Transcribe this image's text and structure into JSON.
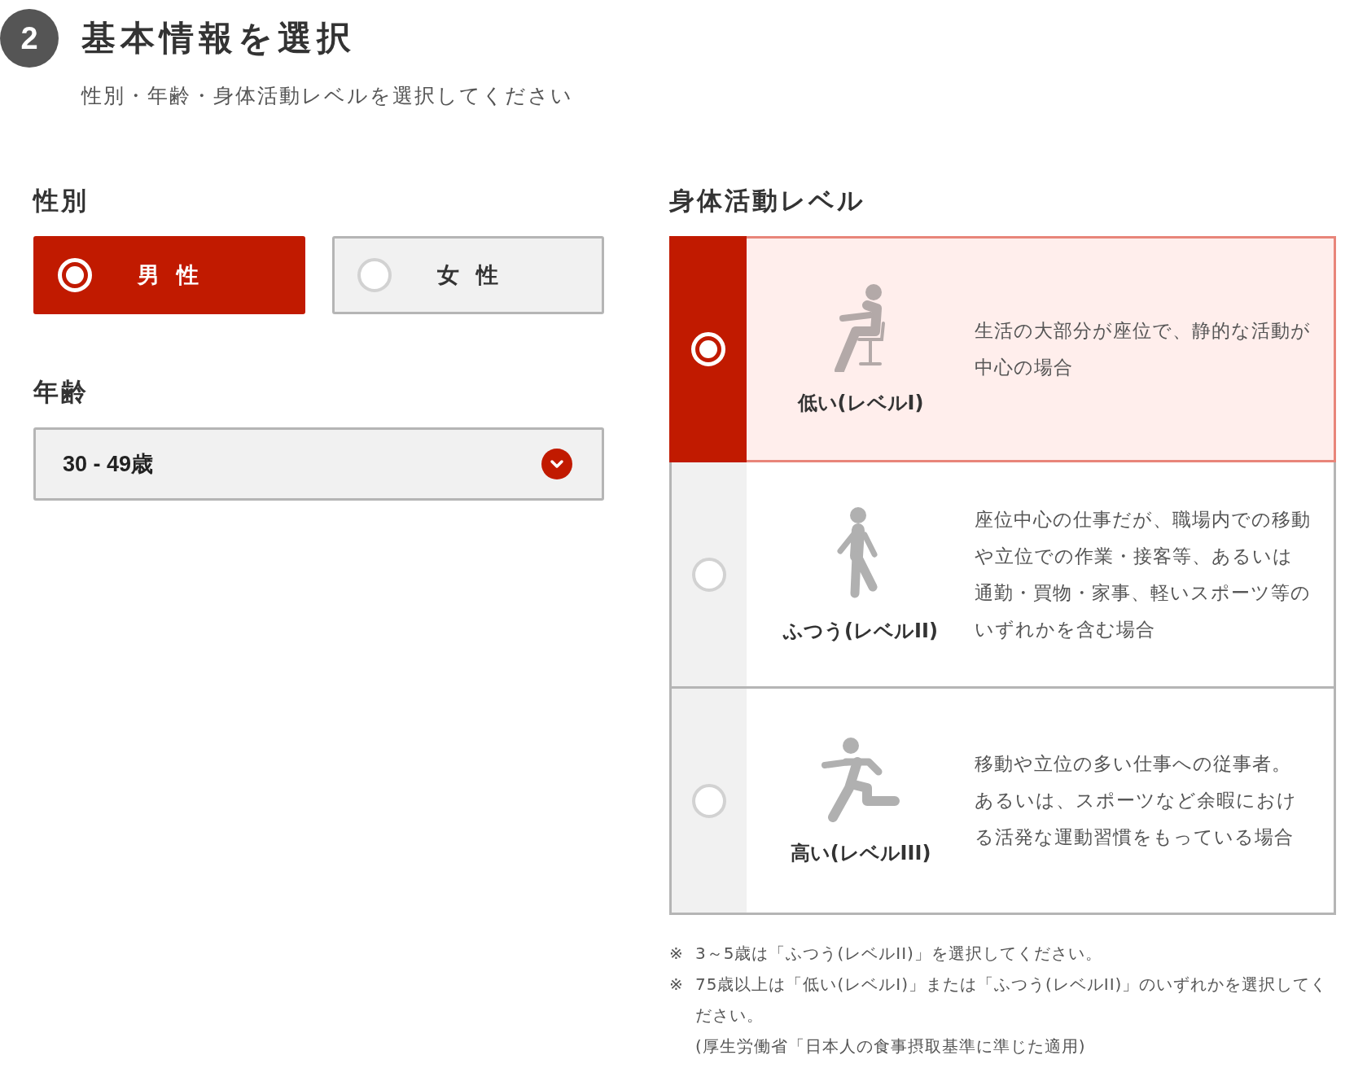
{
  "step": {
    "number": "2",
    "title": "基本情報を選択",
    "subtitle": "性別・年齢・身体活動レベルを選択してください"
  },
  "gender": {
    "label": "性別",
    "options": [
      {
        "label": "男 性",
        "selected": true
      },
      {
        "label": "女 性",
        "selected": false
      }
    ]
  },
  "age": {
    "label": "年齢",
    "value": "30 - 49歳"
  },
  "activity": {
    "label": "身体活動レベル",
    "levels": [
      {
        "name": "低い(レベルI)",
        "description": "生活の大部分が座位で、静的な活動が中心の場合",
        "selected": true
      },
      {
        "name": "ふつう(レベルII)",
        "description": "座位中心の仕事だが、職場内での移動や立位での作業・接客等、あるいは通勤・買物・家事、軽いスポーツ等のいずれかを含む場合",
        "selected": false
      },
      {
        "name": "高い(レベルIII)",
        "description": "移動や立位の多い仕事への従事者。あるいは、スポーツなど余暇における活発な運動習慣をもっている場合",
        "selected": false
      }
    ],
    "notes": [
      {
        "mark": "※",
        "text": "3～5歳は「ふつう(レベルII)」を選択してください。"
      },
      {
        "mark": "※",
        "text": "75歳以上は「低い(レベルI)」または「ふつう(レベルII)」のいずれかを選択してください。"
      }
    ],
    "source": "(厚生労働省「日本人の食事摂取基準に準じた適用)"
  }
}
